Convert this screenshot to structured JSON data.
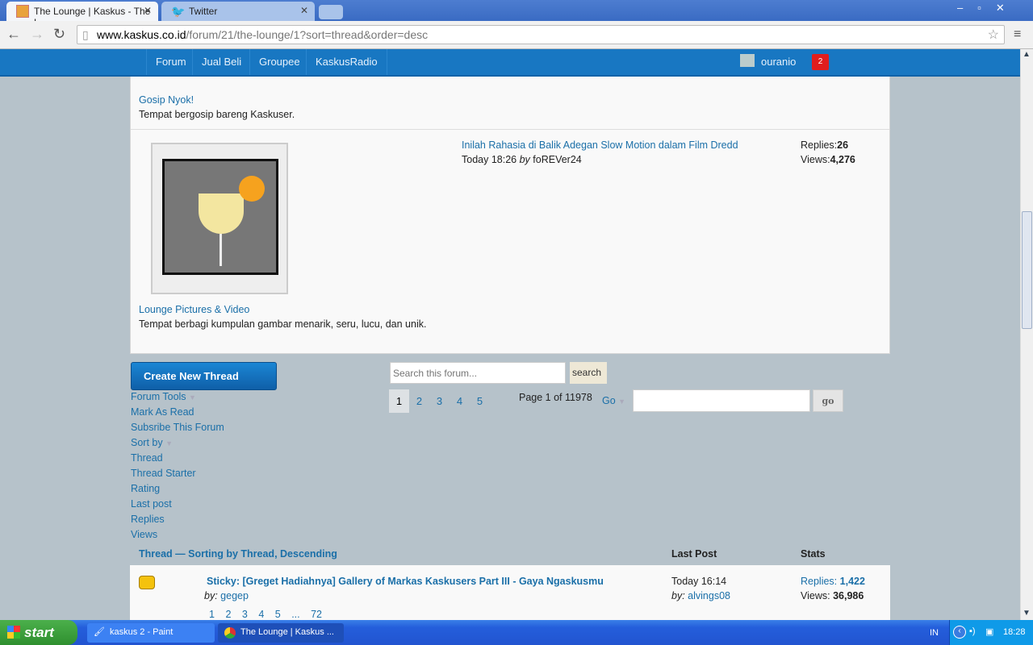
{
  "browser": {
    "tabs": [
      {
        "title": "The Lounge | Kaskus - The L"
      },
      {
        "title": "Twitter"
      }
    ],
    "url_domain": "www.kaskus.co.id",
    "url_path": "/forum/21/the-lounge/1?sort=thread&order=desc"
  },
  "nav": {
    "items": [
      "Forum",
      "Jual Beli",
      "Groupee",
      "KaskusRadio"
    ],
    "username": "ouranio",
    "notifications": "2"
  },
  "subforums": [
    {
      "title": "Gosip Nyok!",
      "desc": "Tempat bergosip bareng Kaskuser."
    },
    {
      "title": "Lounge Pictures & Video",
      "desc": "Tempat berbagi kumpulan gambar menarik, seru, lucu, dan unik.",
      "last_thread": "Inilah Rahasia di Balik Adegan Slow Motion dalam Film Dredd",
      "last_time": "Today 18:26",
      "by": "by",
      "last_user": "foREVer24",
      "replies_label": "Replies:",
      "replies": "26",
      "views_label": "Views:",
      "views": "4,276"
    }
  ],
  "tools": {
    "create": "Create New Thread",
    "forum_tools": "Forum Tools",
    "mark_read": "Mark As Read",
    "subscribe": "Subsribe This Forum",
    "sort_by": "Sort by",
    "sort_options": [
      "Thread",
      "Thread Starter",
      "Rating",
      "Last post",
      "Replies",
      "Views"
    ]
  },
  "search": {
    "placeholder": "Search this forum...",
    "button": "search"
  },
  "pagination": {
    "pages": [
      "1",
      "2",
      "3",
      "4",
      "5"
    ],
    "current": "1",
    "info": "Page 1 of 11978",
    "go_label": "Go",
    "go_button": "go"
  },
  "table": {
    "head_thread": "Thread — Sorting by Thread, Descending",
    "head_last": "Last Post",
    "head_stats": "Stats",
    "rows": [
      {
        "title": "Sticky: [Greget Hadiahnya] Gallery of Markas Kaskusers Part III - Gaya Ngaskusmu",
        "by": "by:",
        "starter": "gegep",
        "pages": [
          "1",
          "2",
          "3",
          "4",
          "5",
          "...",
          "72"
        ],
        "last_time": "Today 16:14",
        "last_by": "by:",
        "last_user": "alvings08",
        "replies_label": "Replies:",
        "replies": "1,422",
        "views_label": "Views:",
        "views": "36,986"
      }
    ]
  },
  "taskbar": {
    "start": "start",
    "tasks": [
      "kaskus 2 - Paint",
      "The Lounge | Kaskus ..."
    ],
    "lang": "IN",
    "clock": "18:28"
  }
}
